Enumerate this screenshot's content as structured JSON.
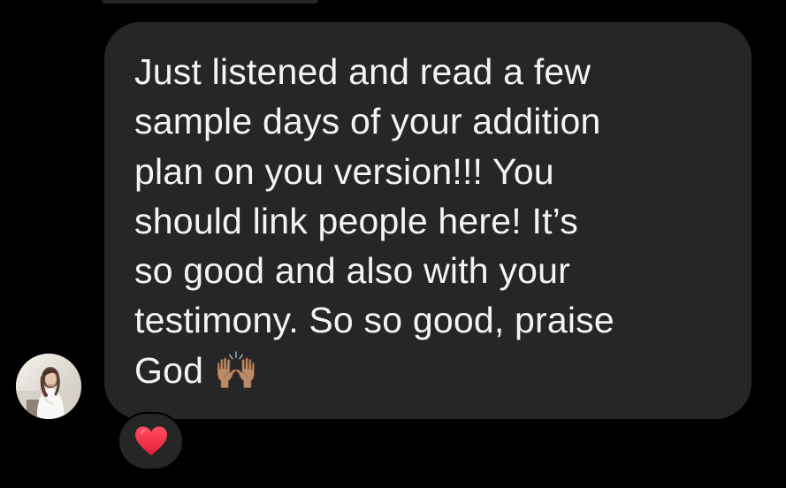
{
  "conversation": {
    "message": {
      "text": "Just listened and read a few\nsample days of your addition\nplan on you version!!! You\nshould link people here! It’s\nso good and also with your\ntestimony. So so  good, praise\nGod 🙌🏽"
    },
    "avatar": {
      "icon": "profile-photo-icon"
    },
    "reaction": {
      "icon": "red-heart-icon",
      "color": "#ff3040"
    }
  }
}
